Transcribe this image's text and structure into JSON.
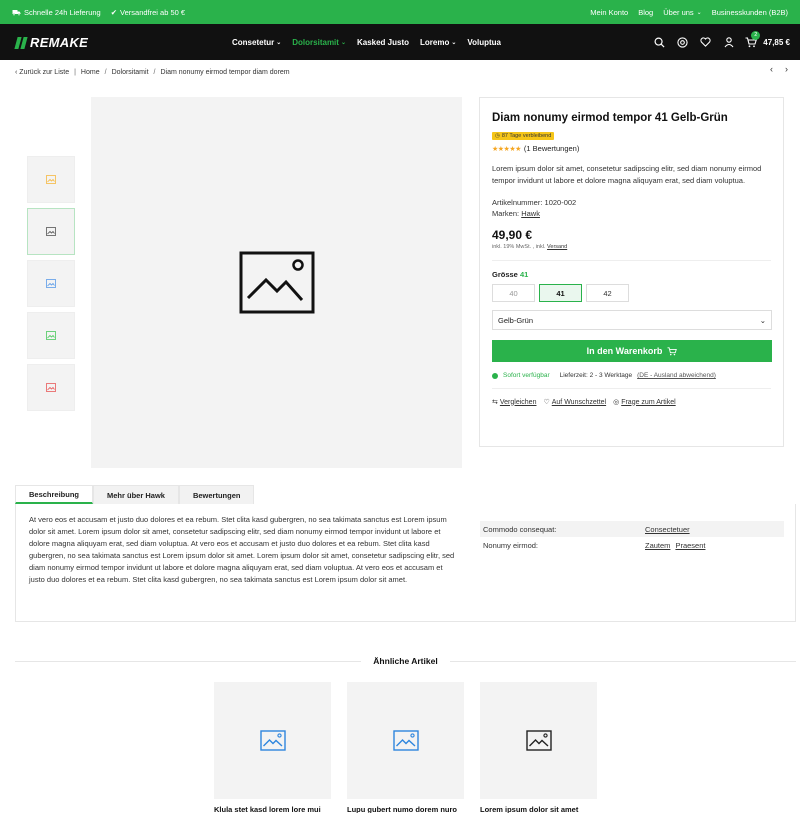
{
  "topbar": {
    "shipping": "Schnelle 24h Lieferung",
    "freeship": "Versandfrei ab 50 €",
    "links": [
      "Mein Konto",
      "Blog",
      "Über uns",
      "Businesskunden (B2B)"
    ]
  },
  "header": {
    "logo": "REMAKE",
    "nav": [
      "Consetetur",
      "Dolorsitamit",
      "Kasked Justo",
      "Loremo",
      "Voluptua"
    ],
    "cart_count": "2",
    "cart_total": "47,85 €"
  },
  "breadcrumb": {
    "back": "Zurück zur Liste",
    "items": [
      "Home",
      "Dolorsitamit",
      "Diam nonumy eirmod tempor diam dorem"
    ]
  },
  "product": {
    "title": "Diam nonumy eirmod tempor 41 Gelb-Grün",
    "deal_badge": "87 Tage verbleibend",
    "rating_stars": 5,
    "rating_text": "(1 Bewertungen)",
    "description": "Lorem ipsum dolor sit amet, consetetur sadipscing elitr, sed diam nonumy eirmod tempor invidunt ut labore et dolore magna aliquyam erat, sed diam voluptua.",
    "article_label": "Artikelnummer:",
    "article_no": "1020-002",
    "brand_label": "Marken:",
    "brand": "Hawk",
    "price": "49,90 €",
    "tax_text": "inkl. 19% MwSt. , inkl.",
    "shipping_link": "Versand",
    "size_label": "Grösse",
    "size_selected": "41",
    "sizes": [
      "40",
      "41",
      "42"
    ],
    "variant": "Gelb-Grün",
    "add_to_cart": "In den Warenkorb",
    "stock": "Sofort verfügbar",
    "delivery": "Lieferzeit: 2 - 3 Werktage",
    "delivery_note": "(DE - Ausland abweichend)",
    "actions": [
      "Vergleichen",
      "Auf Wunschzettel",
      "Frage zum Artikel"
    ]
  },
  "thumb_colors": [
    "#f5b942",
    "#555555",
    "#5b9be8",
    "#4cc95e",
    "#e85b5b"
  ],
  "tabs": [
    "Beschreibung",
    "Mehr über Hawk",
    "Bewertungen"
  ],
  "description_long": "At vero eos et accusam et justo duo dolores et ea rebum. Stet clita kasd gubergren, no sea takimata sanctus est Lorem ipsum dolor sit amet. Lorem ipsum dolor sit amet, consetetur sadipscing elitr, sed diam nonumy eirmod tempor invidunt ut labore et dolore magna aliquyam erat, sed diam voluptua. At vero eos et accusam et justo duo dolores et ea rebum. Stet clita kasd gubergren, no sea takimata sanctus est Lorem ipsum dolor sit amet. Lorem ipsum dolor sit amet, consetetur sadipscing elitr, sed diam nonumy eirmod tempor invidunt ut labore et dolore magna aliquyam erat, sed diam voluptua. At vero eos et accusam et justo duo dolores et ea rebum. Stet clita kasd gubergren, no sea takimata sanctus est Lorem ipsum dolor sit amet.",
  "properties": [
    {
      "key": "Commodo consequat:",
      "values": [
        "Consectetuer"
      ]
    },
    {
      "key": "Nonumy eirmod:",
      "values": [
        "Zautem",
        "Praesent"
      ]
    }
  ],
  "similar": {
    "title": "Ähnliche Artikel",
    "items": [
      {
        "title": "Klula stet kasd lorem lore mui",
        "icon_color": "#2e86de"
      },
      {
        "title": "Lupu gubert numo dorem nuro",
        "icon_color": "#2e86de"
      },
      {
        "title": "Lorem ipsum dolor sit amet",
        "icon_color": "#222222"
      }
    ]
  },
  "colors": {
    "accent": "#2ab24b",
    "header_bg": "#111111",
    "badge": "#f5c518"
  }
}
